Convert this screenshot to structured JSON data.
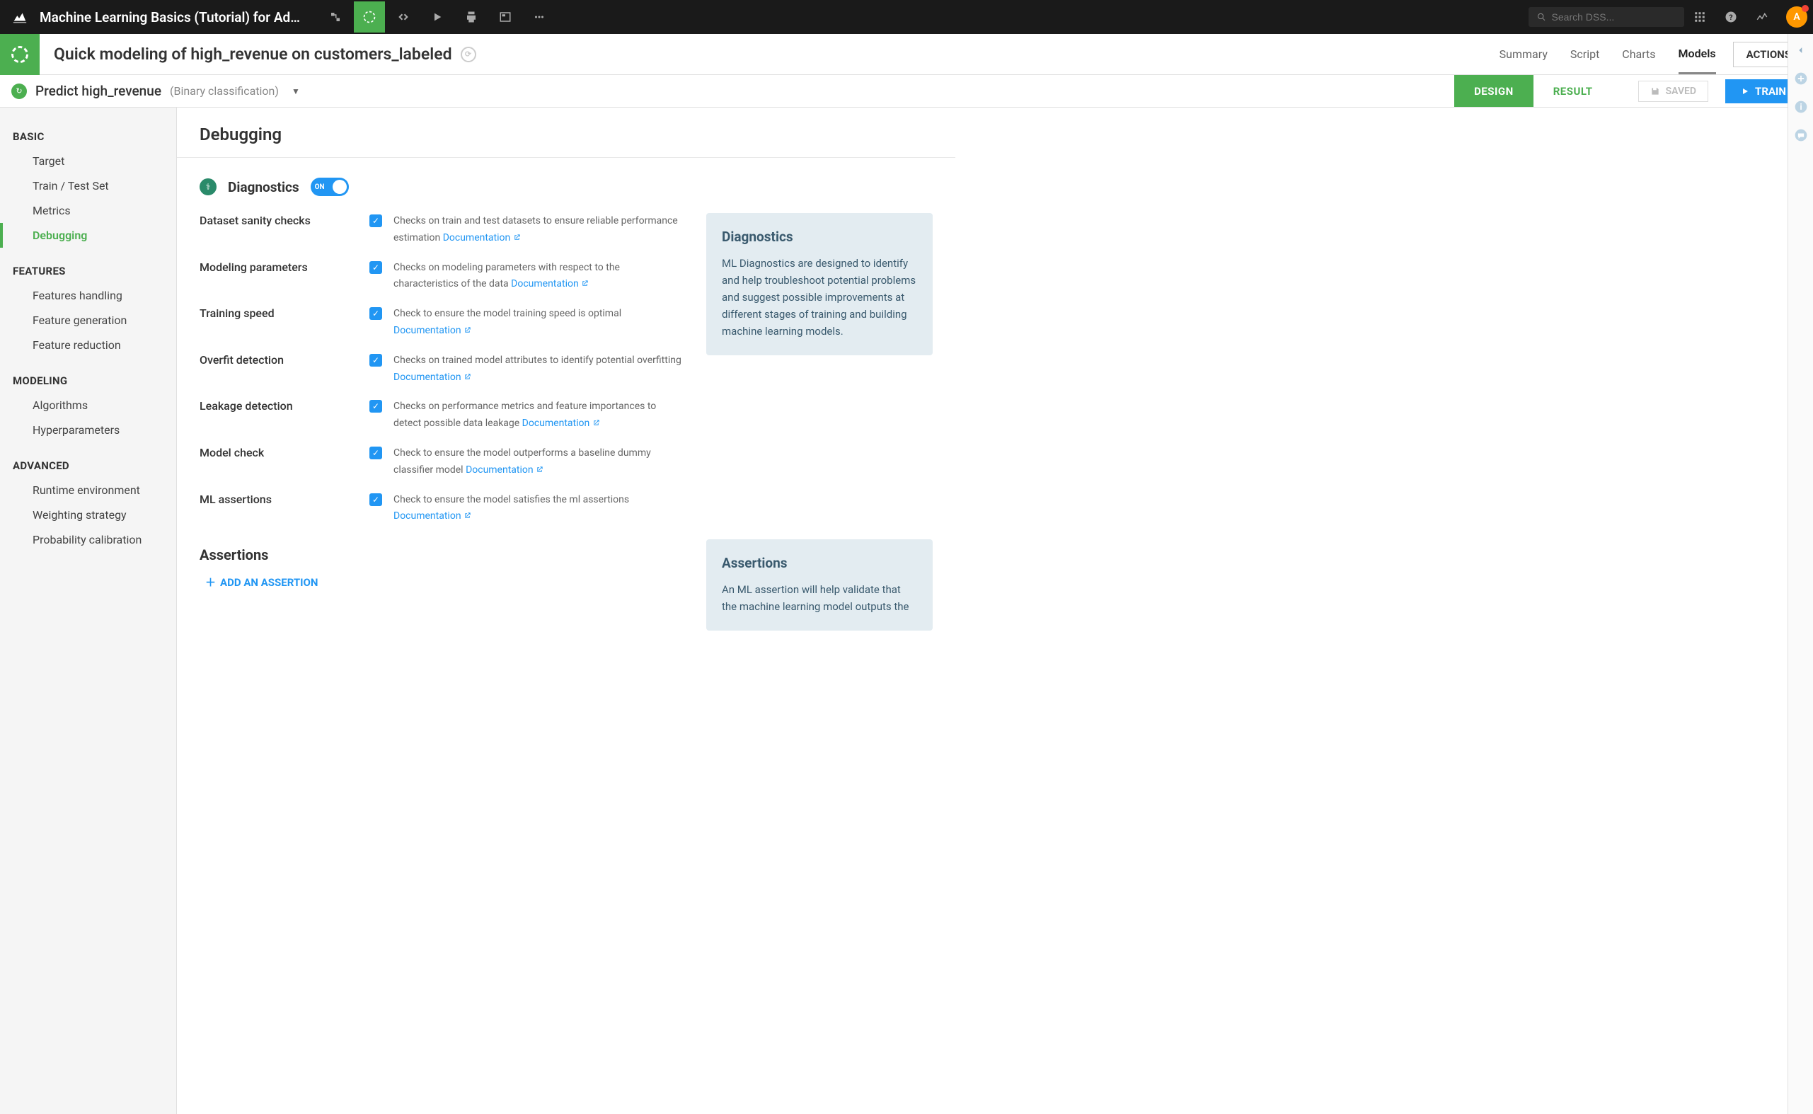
{
  "topbar": {
    "title": "Machine Learning Basics (Tutorial) for Adm…",
    "search_placeholder": "Search DSS...",
    "avatar_letter": "A"
  },
  "subheader": {
    "title": "Quick modeling of high_revenue on customers_labeled",
    "tabs": {
      "summary": "Summary",
      "script": "Script",
      "charts": "Charts",
      "models": "Models"
    },
    "actions": "ACTIONS"
  },
  "tertiary": {
    "predict_title": "Predict high_revenue",
    "predict_sub": "(Binary classification)",
    "design": "DESIGN",
    "result": "RESULT",
    "saved": "SAVED",
    "train": "TRAIN"
  },
  "sidebar": {
    "basic": {
      "title": "BASIC",
      "target": "Target",
      "train_test": "Train / Test Set",
      "metrics": "Metrics",
      "debugging": "Debugging"
    },
    "features": {
      "title": "FEATURES",
      "handling": "Features handling",
      "generation": "Feature generation",
      "reduction": "Feature reduction"
    },
    "modeling": {
      "title": "MODELING",
      "algorithms": "Algorithms",
      "hyper": "Hyperparameters"
    },
    "advanced": {
      "title": "ADVANCED",
      "runtime": "Runtime environment",
      "weighting": "Weighting strategy",
      "prob": "Probability calibration"
    }
  },
  "content": {
    "page_title": "Debugging",
    "diagnostics_label": "Diagnostics",
    "toggle_on": "ON",
    "doc_link": "Documentation",
    "checks": {
      "sanity": {
        "label": "Dataset sanity checks",
        "desc": "Checks on train and test datasets to ensure reliable performance estimation "
      },
      "modeling": {
        "label": "Modeling parameters",
        "desc": "Checks on modeling parameters with respect to the characteristics of the data "
      },
      "speed": {
        "label": "Training speed",
        "desc": "Check to ensure the model training speed is optimal "
      },
      "overfit": {
        "label": "Overfit detection",
        "desc": "Checks on trained model attributes to identify potential overfitting "
      },
      "leakage": {
        "label": "Leakage detection",
        "desc": "Checks on performance metrics and feature importances to detect possible data leakage "
      },
      "modelcheck": {
        "label": "Model check",
        "desc": "Check to ensure the model outperforms a baseline dummy classifier model "
      },
      "mlassert": {
        "label": "ML assertions",
        "desc": "Check to ensure the model satisfies the ml assertions "
      }
    },
    "info_diag_title": "Diagnostics",
    "info_diag_body": "ML Diagnostics are designed to identify and help troubleshoot potential problems and suggest possible improvements at different stages of training and building machine learning models.",
    "assertions_title": "Assertions",
    "add_assertion": "ADD AN ASSERTION",
    "info_assert_title": "Assertions",
    "info_assert_body": "An ML assertion will help validate that the machine learning model outputs the"
  }
}
